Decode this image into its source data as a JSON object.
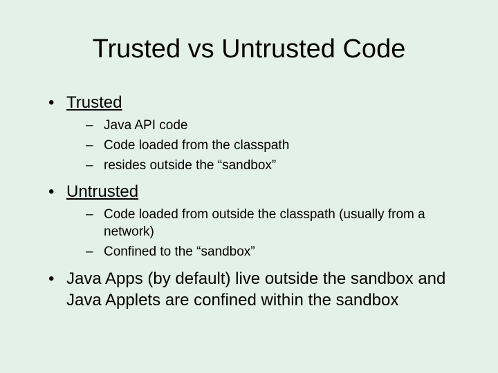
{
  "title": "Trusted vs Untrusted Code",
  "bullets": [
    {
      "text": "Trusted",
      "underline": true,
      "sub": [
        "Java API code",
        "Code loaded from the classpath",
        "resides outside the “sandbox”"
      ]
    },
    {
      "text": "Untrusted",
      "underline": true,
      "sub": [
        "Code loaded from outside the classpath (usually from a network)",
        "Confined to the “sandbox”"
      ]
    },
    {
      "text": "Java Apps (by default) live outside the sandbox and Java Applets are confined within the sandbox",
      "underline": false,
      "sub": []
    }
  ]
}
